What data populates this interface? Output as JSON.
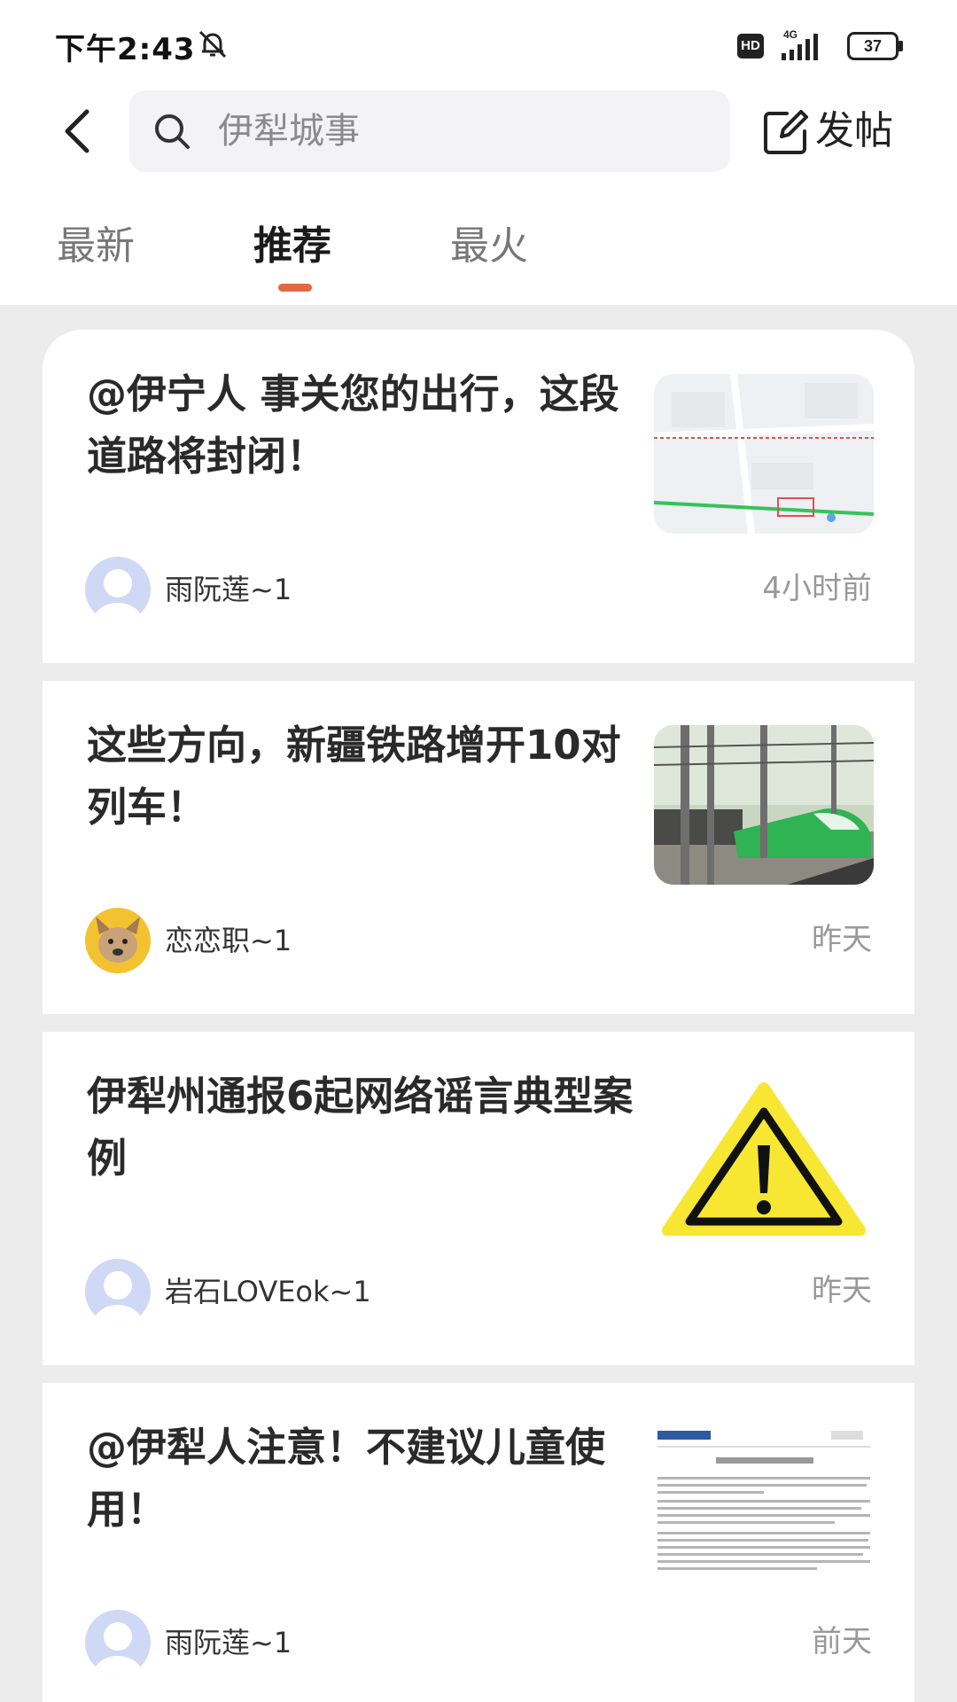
{
  "status_bar": {
    "time": "下午2:43",
    "hd": "HD",
    "network": "4G",
    "battery": "37"
  },
  "header": {
    "search_placeholder": "伊犁城事",
    "post_label": "发帖"
  },
  "tabs": [
    {
      "label": "最新",
      "active": false
    },
    {
      "label": "推荐",
      "active": true
    },
    {
      "label": "最火",
      "active": false
    }
  ],
  "colors": {
    "accent": "#e06a43",
    "background": "#ececec",
    "card": "#ffffff"
  },
  "feed": [
    {
      "title": "@伊宁人 事关您的出行，这段道路将封闭！",
      "author": "雨阮莲~1",
      "time": "4小时前",
      "thumbnail": "map-image"
    },
    {
      "title": "这些方向，新疆铁路增开10对列车！",
      "author": "恋恋职~1",
      "time": "昨天",
      "thumbnail": "train-image"
    },
    {
      "title": "伊犁州通报6起网络谣言典型案例",
      "author": "岩石LOVEok~1",
      "time": "昨天",
      "thumbnail": "warning-image"
    },
    {
      "title": "@伊犁人注意！不建议儿童使用！",
      "author": "雨阮莲~1",
      "time": "前天",
      "thumbnail": "document-image"
    }
  ]
}
